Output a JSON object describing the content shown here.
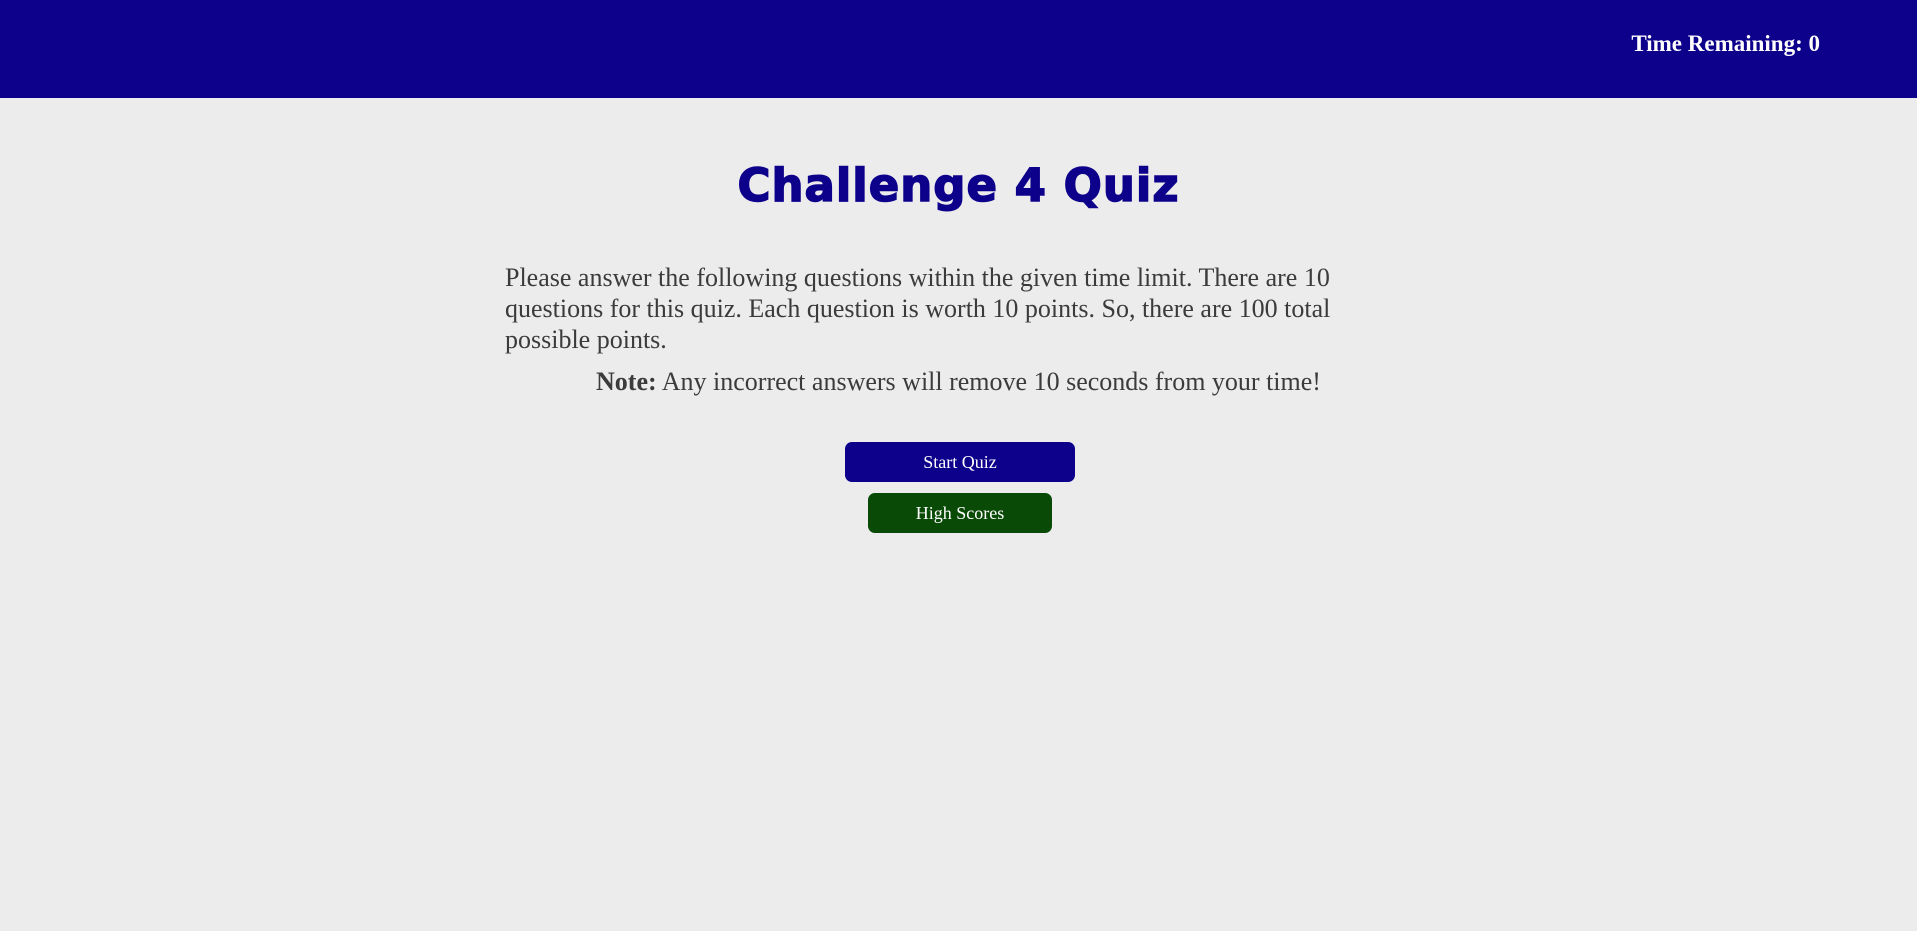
{
  "header": {
    "timer_label": "Time Remaining:",
    "timer_value": "0"
  },
  "main": {
    "title": "Challenge 4 Quiz",
    "intro": "Please answer the following questions within the given time limit. There are 10 questions for this quiz. Each question is worth 10 points. So, there are 100 total possible points.",
    "note_label": "Note:",
    "note_text": "Any incorrect answers will remove 10 seconds from your time!"
  },
  "buttons": {
    "start_label": "Start Quiz",
    "scores_label": "High Scores"
  },
  "colors": {
    "primary": "#0d008a",
    "secondary": "#0a4a07",
    "background": "#ececec",
    "text": "#3b3b3b"
  }
}
